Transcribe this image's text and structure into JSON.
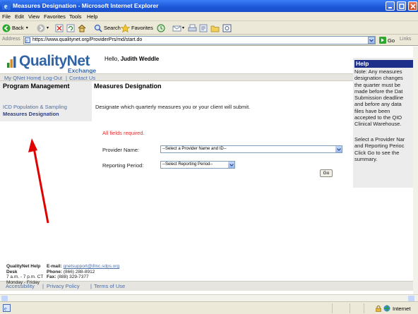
{
  "window": {
    "title": "Measures Designation - Microsoft Internet Explorer"
  },
  "menu": [
    "File",
    "Edit",
    "View",
    "Favorites",
    "Tools",
    "Help"
  ],
  "toolbar": {
    "back_label": "Back",
    "search_label": "Search",
    "favorites_label": "Favorites"
  },
  "address": {
    "label": "Address",
    "url": "https://www.qualitynet.org/ProviderPrs/md/start.do",
    "go_label": "Go",
    "links_label": "Links"
  },
  "site": {
    "logo_text": "QualityNet",
    "logo_sub": "Exchange",
    "greeting": "Hello, ",
    "user_name": "Judith Weddle"
  },
  "nav": {
    "items": [
      "My QNet Home",
      "Log-Out",
      "Contact Us"
    ],
    "separator": "|"
  },
  "sidebar": {
    "heading": "Program Management",
    "items": [
      "ICD Population & Sampling",
      "Measures Designation"
    ]
  },
  "main": {
    "heading": "Measures Designation",
    "description": "Designate which quarterly measures you or your client will submit.",
    "required_note": "All fields required.",
    "provider_label": "Provider Name:",
    "provider_value": "--Select a Provider Name and ID--",
    "period_label": "Reporting Period:",
    "period_value": "--Select Reporting Period--",
    "go_button": "Go"
  },
  "help": {
    "heading": "Help",
    "note": "Note: Any measures\ndesignation changes\nthe quarter must be\nmade before the Dat\nSubmission deadline\nand before any data\nfiles have been\naccepted to the QIO\nClinical Warehouse.",
    "instructions": "Select a Provider Nar\nand Reporting Perioc\nClick Go to see the\nsummary."
  },
  "footer": {
    "links": [
      "Accessibility",
      "Privacy Policy",
      "Terms of Use"
    ],
    "separator": "|",
    "help_title": "QualityNet Help\nDesk",
    "hours": "7 a.m. - 7 p.m. CT\nMonday - Friday",
    "email_label": "E-mail:",
    "email": "qnetsupport@ifmc.sdps.org",
    "phone_label": "Phone:",
    "phone": "(866) 288-8912",
    "fax_label": "Fax:",
    "fax": "(888) 329-7377"
  },
  "status": {
    "zone": "Internet"
  },
  "colors": {
    "brand_blue": "#3164a4",
    "required_red": "#e23030",
    "help_header": "#1e2f8a",
    "annotation_arrow": "#e00000"
  }
}
